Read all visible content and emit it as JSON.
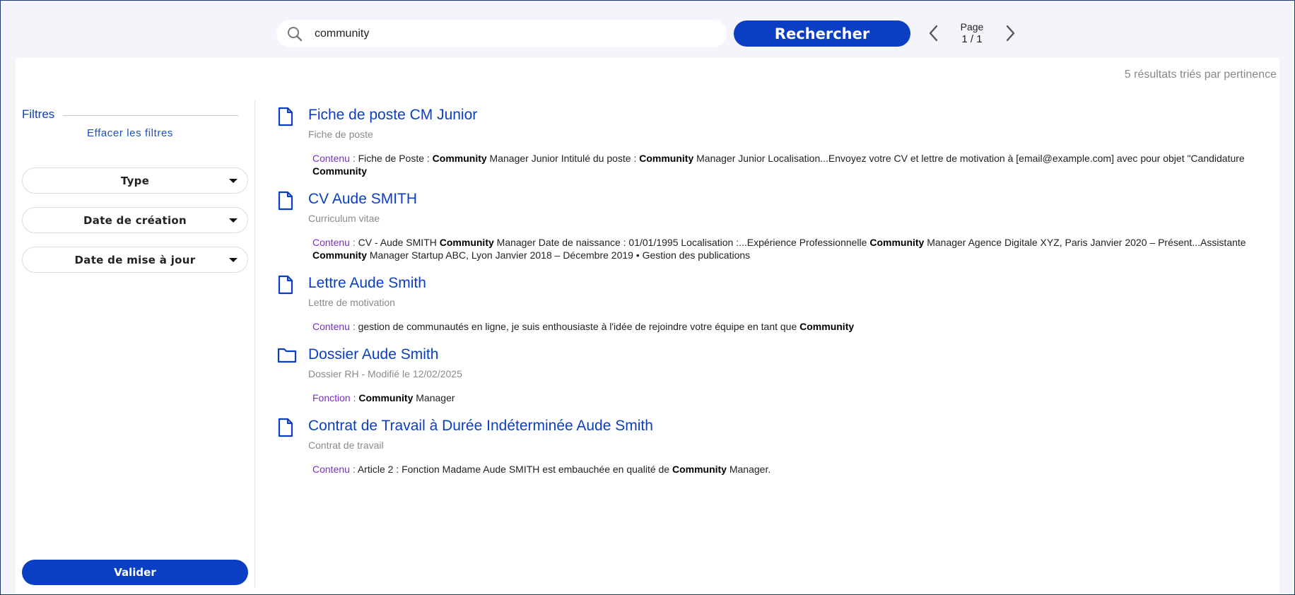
{
  "search": {
    "value": "community",
    "button_label": "Rechercher"
  },
  "pager": {
    "label": "Page",
    "current": "1",
    "separator": "/",
    "total": "1"
  },
  "results_summary": "5 résultats triés par pertinence",
  "sidebar": {
    "filters_title": "Filtres",
    "clear_filters": "Effacer les filtres",
    "dropdowns": [
      {
        "label": "Type"
      },
      {
        "label": "Date de création"
      },
      {
        "label": "Date de mise à jour"
      }
    ],
    "validate_label": "Valider"
  },
  "colors": {
    "accent": "#0a3fc3",
    "snippet_key": "#7a2ec6"
  },
  "results": [
    {
      "icon": "file-icon",
      "title": "Fiche de poste CM Junior",
      "subtitle": "Fiche de poste",
      "snippet_label": "Contenu :",
      "snippet": [
        {
          "t": " Fiche de Poste : "
        },
        {
          "t": "Community",
          "b": true
        },
        {
          "t": " Manager Junior Intitulé du poste : "
        },
        {
          "t": "Community",
          "b": true
        },
        {
          "t": " Manager Junior Localisation...Envoyez votre CV et lettre de motivation à [email@example.com] avec pour objet \"Candidature "
        },
        {
          "t": "Community",
          "b": true
        }
      ]
    },
    {
      "icon": "file-icon",
      "title": "CV Aude SMITH",
      "subtitle": "Curriculum vitae",
      "snippet_label": "Contenu :",
      "snippet": [
        {
          "t": " CV - Aude SMITH "
        },
        {
          "t": "Community",
          "b": true
        },
        {
          "t": " Manager Date de naissance : 01/01/1995 Localisation :...Expérience Professionnelle "
        },
        {
          "t": "Community",
          "b": true
        },
        {
          "t": " Manager Agence Digitale XYZ, Paris Janvier 2020 – Présent...Assistante "
        },
        {
          "t": "Community",
          "b": true
        },
        {
          "t": " Manager Startup ABC, Lyon Janvier 2018 – Décembre 2019 • Gestion des publications"
        }
      ]
    },
    {
      "icon": "file-icon",
      "title": "Lettre Aude Smith",
      "subtitle": "Lettre de motivation",
      "snippet_label": "Contenu :",
      "snippet": [
        {
          "t": " gestion de communautés en ligne, je suis enthousiaste à l'idée de rejoindre votre équipe en tant que "
        },
        {
          "t": "Community",
          "b": true
        }
      ]
    },
    {
      "icon": "folder-icon",
      "title": "Dossier Aude Smith",
      "subtitle": "Dossier RH - Modifié le 12/02/2025",
      "snippet_label": "Fonction :",
      "snippet": [
        {
          "t": " "
        },
        {
          "t": "Community",
          "b": true
        },
        {
          "t": " Manager"
        }
      ]
    },
    {
      "icon": "file-icon",
      "title": "Contrat de Travail à Durée Indéterminée Aude Smith",
      "subtitle": "Contrat de travail",
      "snippet_label": "Contenu :",
      "snippet": [
        {
          "t": " Article 2 : Fonction Madame Aude SMITH est embauchée en qualité de "
        },
        {
          "t": "Community",
          "b": true
        },
        {
          "t": " Manager."
        }
      ]
    }
  ]
}
